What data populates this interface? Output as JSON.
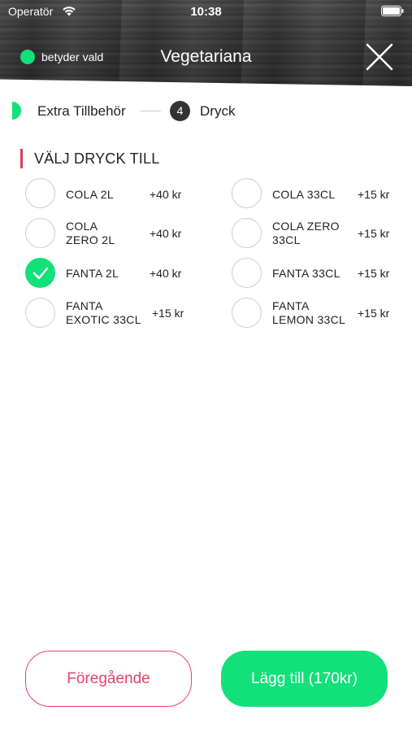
{
  "status_bar": {
    "carrier": "Operatör",
    "time": "10:38"
  },
  "header": {
    "legend_label": "betyder vald",
    "title": "Vegetariana",
    "accent_color": "#12e07a"
  },
  "stepper": {
    "previous_step_label": "Extra Tillbehör",
    "current_step_number": "4",
    "current_step_label": "Dryck"
  },
  "section": {
    "title": "VÄLJ DRYCK TILL",
    "accent_color": "#e63a5a"
  },
  "options": [
    {
      "name_line1": "COLA 2L",
      "name_line2": "",
      "price": "+40 kr",
      "selected": false
    },
    {
      "name_line1": "COLA 33CL",
      "name_line2": "",
      "price": "+15 kr",
      "selected": false
    },
    {
      "name_line1": "COLA",
      "name_line2": "ZERO 2L",
      "price": "+40 kr",
      "selected": false
    },
    {
      "name_line1": "COLA ZERO",
      "name_line2": "33CL",
      "price": "+15 kr",
      "selected": false
    },
    {
      "name_line1": "FANTA 2L",
      "name_line2": "",
      "price": "+40 kr",
      "selected": true
    },
    {
      "name_line1": "FANTA 33CL",
      "name_line2": "",
      "price": "+15 kr",
      "selected": false
    },
    {
      "name_line1": "FANTA",
      "name_line2": "EXOTIC 33CL",
      "price": "+15 kr",
      "selected": false
    },
    {
      "name_line1": "FANTA",
      "name_line2": "LEMON 33CL",
      "price": "+15 kr",
      "selected": false
    }
  ],
  "buttons": {
    "previous_label": "Föregående",
    "add_label": "Lägg till (170kr)"
  }
}
